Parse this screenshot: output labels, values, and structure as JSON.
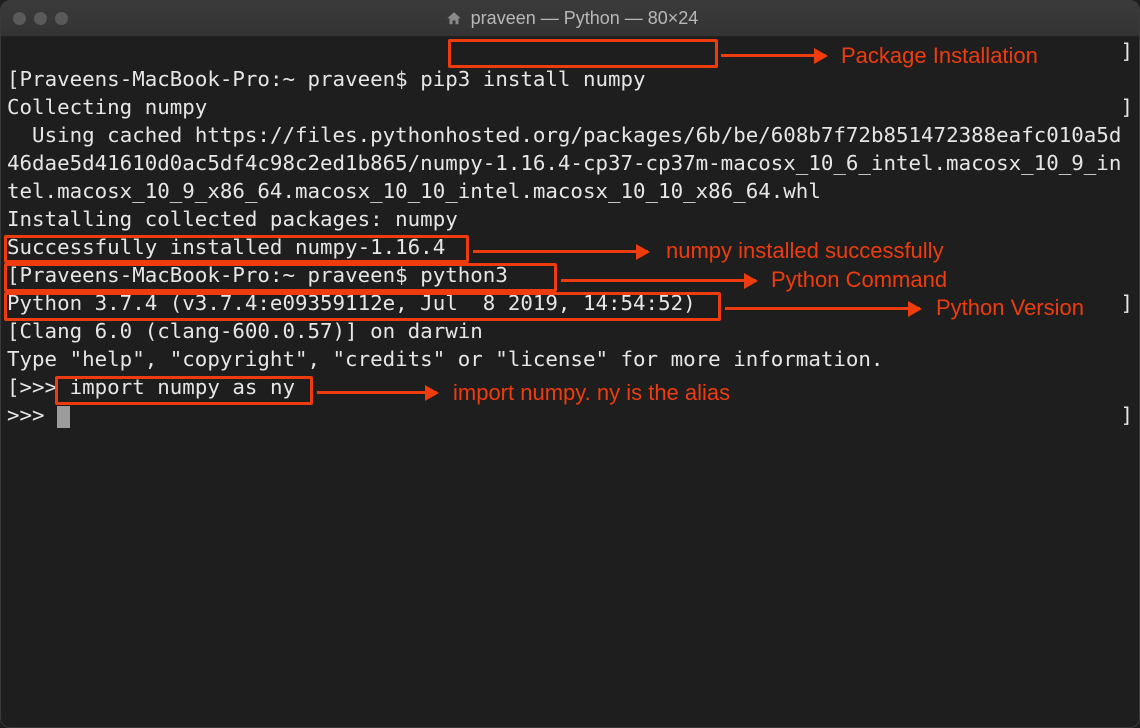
{
  "titlebar": {
    "title": "praveen — Python — 80×24"
  },
  "terminal": {
    "prompt1_pre": "[",
    "prompt1": "Praveens-MacBook-Pro:~ praveen$ ",
    "cmd1": "pip3 install numpy",
    "line2": "Collecting numpy",
    "line3": "  Using cached https://files.pythonhosted.org/packages/6b/be/608b7f72b851472388eafc010a5d46dae5d41610d0ac5df4c98c2ed1b865/numpy-1.16.4-cp37-cp37m-macosx_10_6_intel.macosx_10_9_intel.macosx_10_9_x86_64.macosx_10_10_intel.macosx_10_10_x86_64.whl",
    "line4": "Installing collected packages: numpy",
    "line5": "Successfully installed numpy-1.16.4",
    "prompt2_pre": "[",
    "prompt2": "Praveens-MacBook-Pro:~ praveen$ ",
    "cmd2": "python3",
    "line6": "Python 3.7.4 (v3.7.4:e09359112e, Jul  8 2019, 14:54:52) ",
    "line7": "[Clang 6.0 (clang-600.0.57)] on darwin",
    "line8": "Type \"help\", \"copyright\", \"credits\" or \"license\" for more information.",
    "pyprompt_pre": "[",
    "pyprompt": ">>> ",
    "cmd3": "import numpy as ny",
    "pyprompt2": ">>> ",
    "rbracket": "]"
  },
  "annotations": {
    "a1": "Package Installation",
    "a2": "numpy installed successfully",
    "a3": "Python Command",
    "a4": "Python Version",
    "a5": "import numpy. ny is the alias"
  }
}
